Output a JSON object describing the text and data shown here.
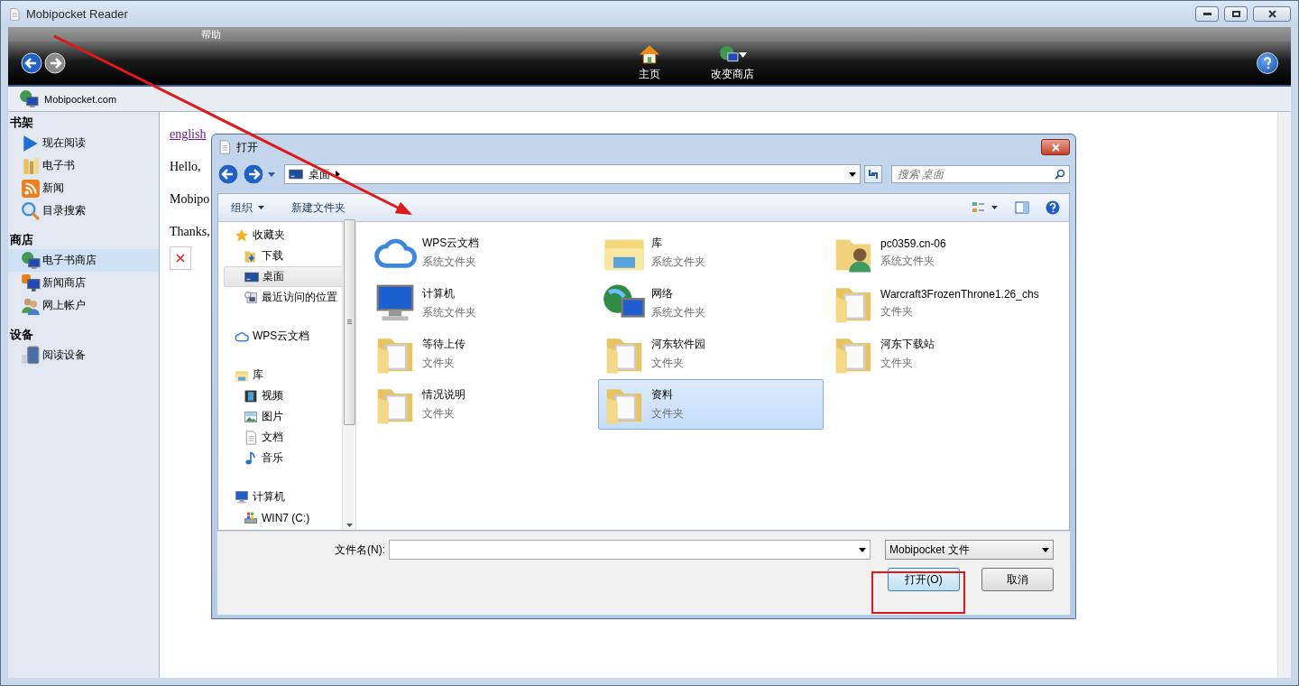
{
  "window": {
    "title": "Mobipocket Reader",
    "menu": [
      "帮助"
    ]
  },
  "toolbar": {
    "buttons": [
      {
        "label": "主页",
        "kind": "home"
      },
      {
        "label": "改变商店",
        "kind": "store"
      }
    ]
  },
  "address": "Mobipocket.com",
  "sidebar": {
    "sections": [
      {
        "title": "书架",
        "items": [
          {
            "label": "现在阅读",
            "kind": "play",
            "selected": false
          },
          {
            "label": "电子书",
            "kind": "books",
            "selected": false
          },
          {
            "label": "新闻",
            "kind": "rss",
            "selected": false
          },
          {
            "label": "目录搜索",
            "kind": "magnifier",
            "selected": false
          }
        ]
      },
      {
        "title": "商店",
        "items": [
          {
            "label": "电子书商店",
            "kind": "globe",
            "selected": true
          },
          {
            "label": "新闻商店",
            "kind": "rssmonitor",
            "selected": false
          },
          {
            "label": "网上帐户",
            "kind": "users",
            "selected": false
          }
        ]
      },
      {
        "title": "设备",
        "items": [
          {
            "label": "阅读设备",
            "kind": "device",
            "selected": false
          }
        ]
      }
    ]
  },
  "content": {
    "link": "english",
    "lines": [
      "Hello,",
      "Mobipo",
      "Thanks,"
    ]
  },
  "dialog": {
    "title": "打开",
    "path": "桌面",
    "search": {
      "placeholder": "搜索 桌面"
    },
    "commands": [
      "组织",
      "新建文件夹"
    ],
    "nav": [
      {
        "label": "收藏夹",
        "kind": "star",
        "selected": false,
        "children": [
          {
            "label": "下载",
            "kind": "download",
            "selected": false
          },
          {
            "label": "桌面",
            "kind": "desktop",
            "selected": true
          },
          {
            "label": "最近访问的位置",
            "kind": "recent",
            "selected": false
          }
        ]
      },
      {
        "label": "WPS云文档",
        "kind": "cloud",
        "selected": false
      },
      {
        "label": "库",
        "kind": "library",
        "selected": false,
        "children": [
          {
            "label": "视频",
            "kind": "video",
            "selected": false
          },
          {
            "label": "图片",
            "kind": "image",
            "selected": false
          },
          {
            "label": "文档",
            "kind": "document",
            "selected": false
          },
          {
            "label": "音乐",
            "kind": "music",
            "selected": false
          }
        ]
      },
      {
        "label": "计算机",
        "kind": "computer",
        "selected": false,
        "children": [
          {
            "label": "WIN7 (C:)",
            "kind": "drive",
            "selected": false
          }
        ]
      }
    ],
    "items": [
      {
        "name": "WPS云文档",
        "type": "系统文件夹",
        "kind": "cloud",
        "selected": false
      },
      {
        "name": "库",
        "type": "系统文件夹",
        "kind": "library",
        "selected": false
      },
      {
        "name": "pc0359.cn-06",
        "type": "系统文件夹",
        "kind": "userfolder",
        "selected": false
      },
      {
        "name": "计算机",
        "type": "系统文件夹",
        "kind": "computer",
        "selected": false
      },
      {
        "name": "网络",
        "type": "系统文件夹",
        "kind": "network",
        "selected": false
      },
      {
        "name": "Warcraft3FrozenThrone1.26_chs",
        "type": "文件夹",
        "kind": "folder",
        "selected": false
      },
      {
        "name": "等待上传",
        "type": "文件夹",
        "kind": "folder",
        "selected": false
      },
      {
        "name": "河东软件园",
        "type": "文件夹",
        "kind": "folder",
        "selected": false
      },
      {
        "name": "河东下载站",
        "type": "文件夹",
        "kind": "folder",
        "selected": false
      },
      {
        "name": "情况说明",
        "type": "文件夹",
        "kind": "folder",
        "selected": false
      },
      {
        "name": "资料",
        "type": "文件夹",
        "kind": "folder",
        "selected": true
      }
    ],
    "filename": {
      "label": "文件名(N):"
    },
    "filetype": "Mobipocket 文件",
    "buttons": [
      {
        "label": "打开(O)",
        "kind": "primary"
      },
      {
        "label": "取消",
        "kind": "normal"
      }
    ]
  }
}
